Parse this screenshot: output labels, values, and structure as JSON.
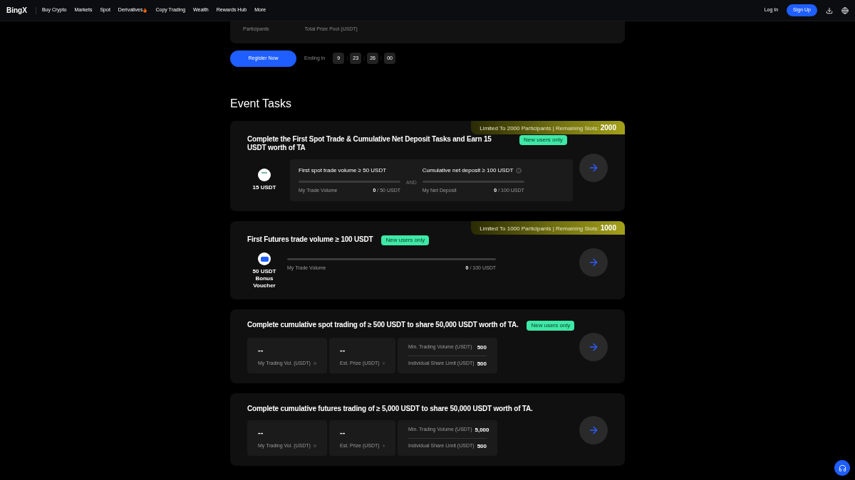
{
  "nav": {
    "logo": "BingX",
    "items": [
      {
        "label": "Buy Crypto",
        "hot": false
      },
      {
        "label": "Markets",
        "hot": false
      },
      {
        "label": "Spot",
        "hot": false
      },
      {
        "label": "Derivatives",
        "hot": true
      },
      {
        "label": "Copy Trading",
        "hot": false
      },
      {
        "label": "Wealth",
        "hot": false
      },
      {
        "label": "Rewards Hub",
        "hot": false
      },
      {
        "label": "More",
        "hot": false
      }
    ],
    "login": "Log In",
    "signup": "Sign Up"
  },
  "summary": {
    "labels": [
      "Participants",
      "Total Prize Pool (USDT)"
    ]
  },
  "register": {
    "button": "Register Now",
    "ending_label": "Ending in",
    "countdown": [
      "9",
      "23",
      "26",
      "00"
    ],
    "separator": ":"
  },
  "section_title": "Event Tasks",
  "tasks": [
    {
      "kind": "dual",
      "title": "Complete the First Spot Trade & Cumulative Net Deposit Tasks and Earn 15 USDT worth of TA",
      "badge": "New users only",
      "limit": {
        "text": "Limited To 2000 Participants | Remaining Slots:",
        "value": "2000"
      },
      "reward": {
        "text": "15 USDT"
      },
      "joiner": "AND",
      "conditions": [
        {
          "title": "First spot trade volume ≥ 50 USDT",
          "info": false,
          "label": "My Trade Volume",
          "current": "0",
          "target": "/ 50 USDT",
          "level": 0
        },
        {
          "title": "Cumulative net deposit ≥ 100 USDT",
          "info": true,
          "label": "My Net Deposit",
          "current": "0",
          "target": "/ 100 USDT",
          "level": 0
        }
      ]
    },
    {
      "kind": "single",
      "title": "First Futures trade volume ≥ 100 USDT",
      "badge": "New users only",
      "limit": {
        "text": "Limited To 1000 Participants | Remaining Slots:",
        "value": "1000"
      },
      "reward": {
        "text": "50 USDT Bonus Voucher"
      },
      "conditions": [
        {
          "label": "My Trade Volume",
          "current": "0",
          "target": "/ 100 USDT",
          "level": 0
        }
      ]
    },
    {
      "kind": "share",
      "title": "Complete cumulative spot trading of ≥ 500 USDT to share 50,000 USDT worth of TA.",
      "badge": "New users only",
      "stats": [
        {
          "value": "--",
          "label": "My Trading Vol. (USDT)"
        },
        {
          "value": "--",
          "label": "Est. Prize (USDT)"
        }
      ],
      "limits": [
        {
          "label": "Min. Trading Volume (USDT)",
          "value": "500"
        },
        {
          "label": "Individual Share Limit (USDT)",
          "value": "500"
        }
      ]
    },
    {
      "kind": "share",
      "title": "Complete cumulative futures trading of ≥ 5,000 USDT to share 50,000 USDT worth of TA.",
      "stats": [
        {
          "value": "--",
          "label": "My Trading Vol. (USDT)"
        },
        {
          "value": "--",
          "label": "Est. Prize (USDT)"
        }
      ],
      "limits": [
        {
          "label": "Min. Trading Volume (USDT)",
          "value": "5,000"
        },
        {
          "label": "Individual Share Limit (USDT)",
          "value": "500"
        }
      ]
    }
  ]
}
